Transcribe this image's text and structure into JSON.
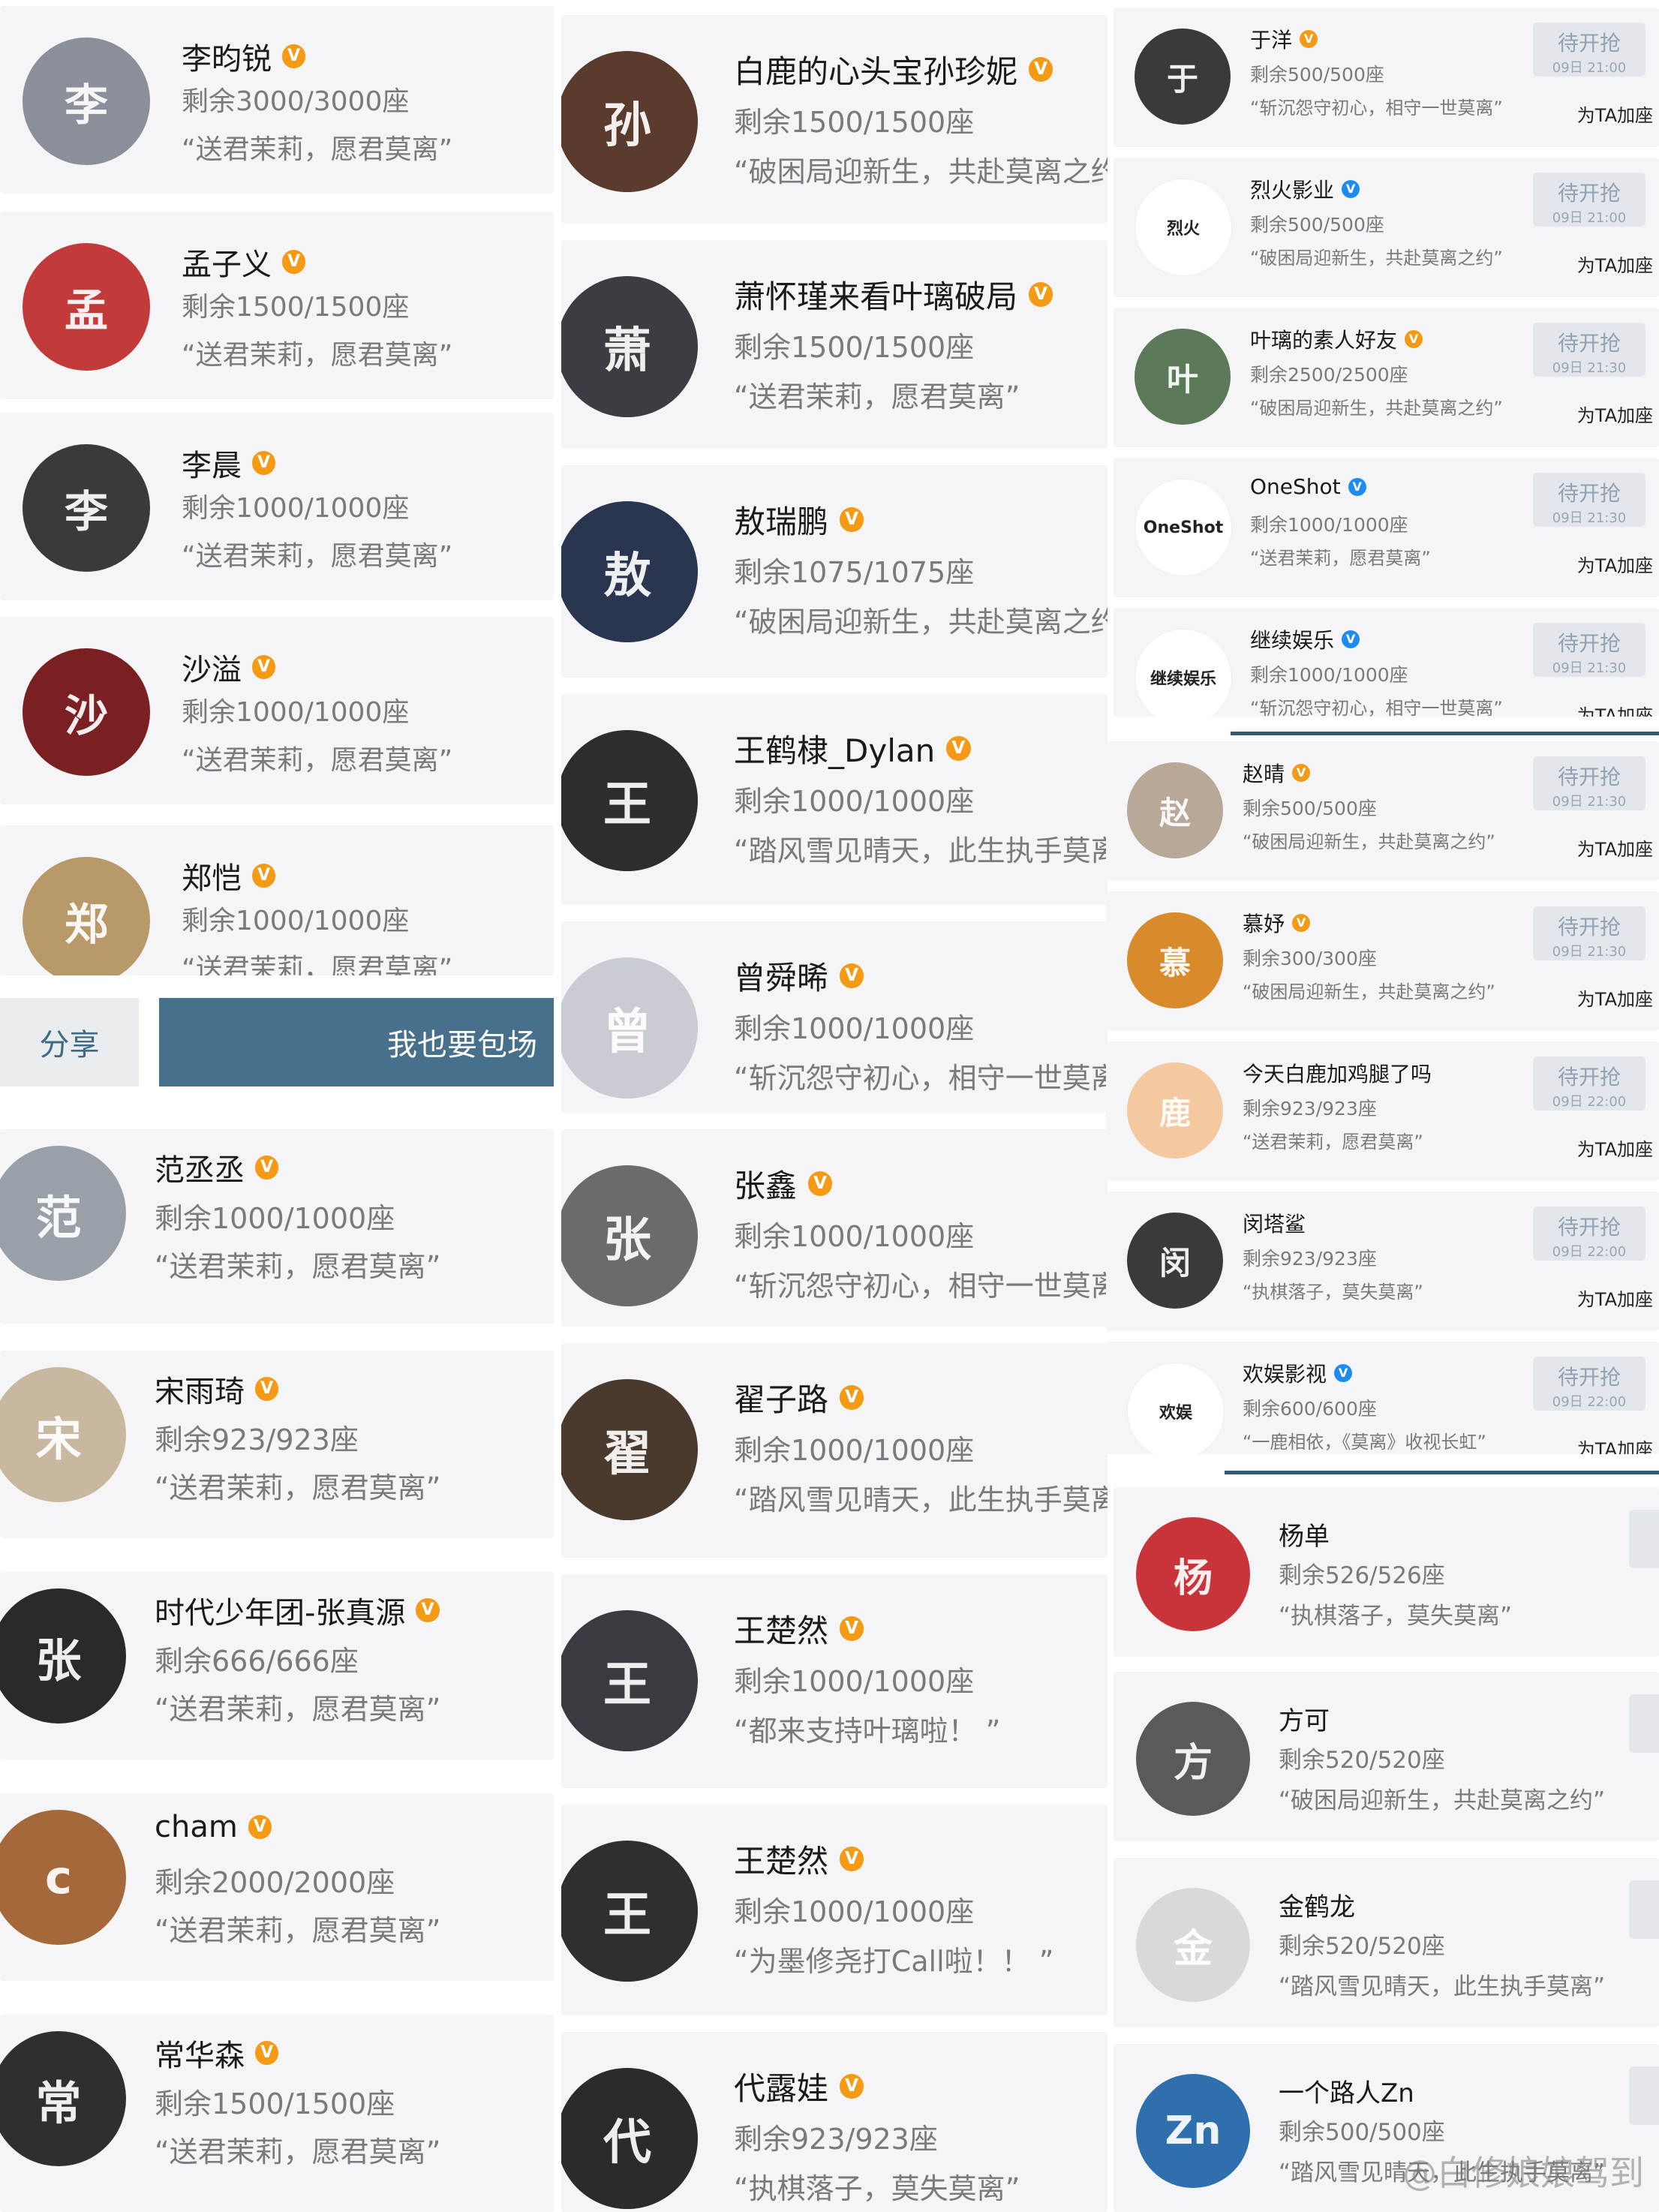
{
  "col1_top": [
    {
      "name": "李昀锐",
      "seats": "剩余3000/3000座",
      "quote": "“送君茉莉，愿君莫离”",
      "color": "#8a8f9a",
      "initial": "李"
    },
    {
      "name": "孟子义",
      "seats": "剩余1500/1500座",
      "quote": "“送君茉莉，愿君莫离”",
      "color": "#c23a3a",
      "initial": "孟"
    },
    {
      "name": "李晨",
      "seats": "剩余1000/1000座",
      "quote": "“送君茉莉，愿君莫离”",
      "color": "#3a3a3a",
      "initial": "李"
    },
    {
      "name": "沙溢",
      "seats": "剩余1000/1000座",
      "quote": "“送君茉莉，愿君莫离”",
      "color": "#7a1f22",
      "initial": "沙"
    },
    {
      "name": "郑恺",
      "seats": "剩余1000/1000座",
      "quote": "“送君茉莉，愿君莫离”",
      "color": "#b89a6a",
      "initial": "郑"
    }
  ],
  "share_bar": {
    "share_label": "分享",
    "book_label": "我也要包场"
  },
  "col1_bottom": [
    {
      "name": "范丞丞",
      "seats": "剩余1000/1000座",
      "quote": "“送君茉莉，愿君莫离”",
      "color": "#9aa0a8",
      "initial": "范"
    },
    {
      "name": "宋雨琦",
      "seats": "剩余923/923座",
      "quote": "“送君茉莉，愿君莫离”",
      "color": "#c9b8a0",
      "initial": "宋"
    },
    {
      "name": "时代少年团-张真源",
      "seats": "剩余666/666座",
      "quote": "“送君茉莉，愿君莫离”",
      "color": "#2a2a2a",
      "initial": "张"
    },
    {
      "name": "cham",
      "seats": "剩余2000/2000座",
      "quote": "“送君茉莉，愿君莫离”",
      "color": "#a5683a",
      "initial": "c"
    },
    {
      "name": "常华森",
      "seats": "剩余1500/1500座",
      "quote": "“送君茉莉，愿君莫离”",
      "color": "#2f2f33",
      "initial": "常"
    }
  ],
  "col2": [
    {
      "name": "白鹿的心头宝孙珍妮",
      "seats": "剩余1500/1500座",
      "quote": "“破困局迎新生，共赴莫离之约”",
      "color": "#5a3b2e",
      "initial": "孙"
    },
    {
      "name": "萧怀瑾来看叶璃破局",
      "seats": "剩余1500/1500座",
      "quote": "“送君茉莉，愿君莫离”",
      "color": "#3c3c42",
      "initial": "萧"
    },
    {
      "name": "敖瑞鹏",
      "seats": "剩余1075/1075座",
      "quote": "“破困局迎新生，共赴莫离之约”",
      "color": "#2a3550",
      "initial": "敖"
    },
    {
      "name": "王鹤棣_Dylan",
      "seats": "剩余1000/1000座",
      "quote": "“踏风雪见晴天，此生执手莫离”",
      "color": "#2d2d2d",
      "initial": "王"
    },
    {
      "name": "曾舜晞",
      "seats": "剩余1000/1000座",
      "quote": "“斩沉怨守初心，相守一世莫离”",
      "color": "#c9ccd2",
      "initial": "曾"
    },
    {
      "name": "张鑫",
      "seats": "剩余1000/1000座",
      "quote": "“斩沉怨守初心，相守一世莫离”",
      "color": "#6b6b6b",
      "initial": "张"
    },
    {
      "name": "翟子路",
      "seats": "剩余1000/1000座",
      "quote": "“踏风雪见晴天，此生执手莫离”",
      "color": "#4a3a2e",
      "initial": "翟"
    },
    {
      "name": "王楚然",
      "seats": "剩余1000/1000座",
      "quote": "“都来支持叶璃啦！ ”",
      "color": "#3a3a40",
      "initial": "王"
    },
    {
      "name": "王楚然",
      "seats": "剩余1000/1000座",
      "quote": "“为墨修尧打Call啦！！ ”",
      "color": "#2e2e33",
      "initial": "王"
    },
    {
      "name": "代露娃",
      "seats": "剩余923/923座",
      "quote": "“执棋落子，莫失莫离”",
      "color": "#2b2b2b",
      "initial": "代"
    }
  ],
  "col3_a": [
    {
      "name": "于洋",
      "badge": "o",
      "seats": "剩余500/500座",
      "quote": "“斩沉怨守初心，相守一世莫离”",
      "grab": "待开抢",
      "time": "09日 21:00",
      "forta": "为TA加座",
      "color": "#3a3a3a",
      "initial": "于"
    },
    {
      "name": "烈火影业",
      "badge": "b",
      "seats": "剩余500/500座",
      "quote": "“破困局迎新生，共赴莫离之约”",
      "grab": "待开抢",
      "time": "09日 21:00",
      "forta": "为TA加座",
      "color": "#ffffff",
      "initial": "烈火",
      "logo": true
    },
    {
      "name": "叶璃的素人好友",
      "badge": "o",
      "seats": "剩余2500/2500座",
      "quote": "“破困局迎新生，共赴莫离之约”",
      "grab": "待开抢",
      "time": "09日 21:30",
      "forta": "为TA加座",
      "color": "#5c7a5a",
      "initial": "叶"
    },
    {
      "name": "OneShot",
      "badge": "b",
      "seats": "剩余1000/1000座",
      "quote": "“送君茉莉，愿君莫离”",
      "grab": "待开抢",
      "time": "09日 21:30",
      "forta": "为TA加座",
      "color": "#ffffff",
      "initial": "OneShot",
      "logo": true
    },
    {
      "name": "继续娱乐",
      "badge": "b",
      "seats": "剩余1000/1000座",
      "quote": "“斩沉怨守初心，相守一世莫离”",
      "grab": "待开抢",
      "time": "09日 21:30",
      "forta": "为TA加座",
      "color": "#ffffff",
      "initial": "继续娱乐",
      "logo": true
    }
  ],
  "col3_b": [
    {
      "name": "赵晴",
      "badge": "o",
      "seats": "剩余500/500座",
      "quote": "“破困局迎新生，共赴莫离之约”",
      "grab": "待开抢",
      "time": "09日 21:30",
      "forta": "为TA加座",
      "color": "#b8a898",
      "initial": "赵"
    },
    {
      "name": "慕妤",
      "badge": "o",
      "seats": "剩余300/300座",
      "quote": "“破困局迎新生，共赴莫离之约”",
      "grab": "待开抢",
      "time": "09日 21:30",
      "forta": "为TA加座",
      "color": "#d98a2a",
      "initial": "慕"
    },
    {
      "name": "今天白鹿加鸡腿了吗",
      "badge": "",
      "seats": "剩余923/923座",
      "quote": "“送君茉莉，愿君莫离”",
      "grab": "待开抢",
      "time": "09日 22:00",
      "forta": "为TA加座",
      "color": "#f4c9a0",
      "initial": "鹿"
    },
    {
      "name": "闵塔鲨",
      "badge": "",
      "seats": "剩余923/923座",
      "quote": "“执棋落子，莫失莫离”",
      "grab": "待开抢",
      "time": "09日 22:00",
      "forta": "为TA加座",
      "color": "#3a3a3a",
      "initial": "闵"
    },
    {
      "name": "欢娱影视",
      "badge": "b",
      "seats": "剩余600/600座",
      "quote": "“一鹿相依，《莫离》收视长虹”",
      "grab": "待开抢",
      "time": "09日 22:00",
      "forta": "为TA加座",
      "color": "#ffffff",
      "initial": "欢娱",
      "logo": true
    }
  ],
  "col3_c": [
    {
      "name": "杨单",
      "seats": "剩余526/526座",
      "quote": "“执棋落子，莫失莫离”",
      "color": "#c8343a",
      "initial": "杨"
    },
    {
      "name": "方可",
      "seats": "剩余520/520座",
      "quote": "“破困局迎新生，共赴莫离之约”",
      "color": "#5a5a5a",
      "initial": "方"
    },
    {
      "name": "金鹤龙",
      "seats": "剩余520/520座",
      "quote": "“踏风雪见晴天，此生执手莫离”",
      "color": "#d9d9db",
      "initial": "金"
    },
    {
      "name": "一个路人Zn",
      "seats": "剩余500/500座",
      "quote": "“踏风雪见晴天，此生执手莫离”",
      "color": "#2f6fae",
      "initial": "Zn"
    }
  ],
  "watermark": "@白修娘娘驾到",
  "verified_mark": "V"
}
